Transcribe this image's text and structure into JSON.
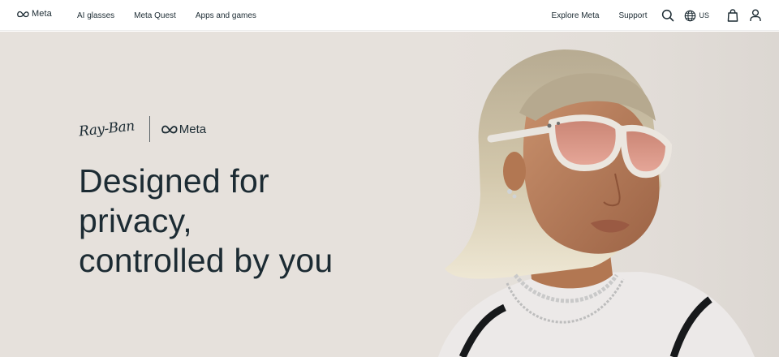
{
  "nav": {
    "brand": "Meta",
    "left_links": [
      "AI glasses",
      "Meta Quest",
      "Apps and games"
    ],
    "explore": "Explore Meta",
    "support": "Support",
    "locale": "US",
    "icons": [
      "search-icon",
      "globe-icon",
      "shopping-bag-icon",
      "account-icon"
    ]
  },
  "hero": {
    "partner_logo": "Ray-Ban",
    "meta_logo": "Meta",
    "headline": [
      "Designed for",
      "privacy,",
      "controlled by you"
    ],
    "background": "#e6e1dc"
  },
  "colors": {
    "text": "#1c2b33",
    "nav_bg": "#ffffff"
  }
}
